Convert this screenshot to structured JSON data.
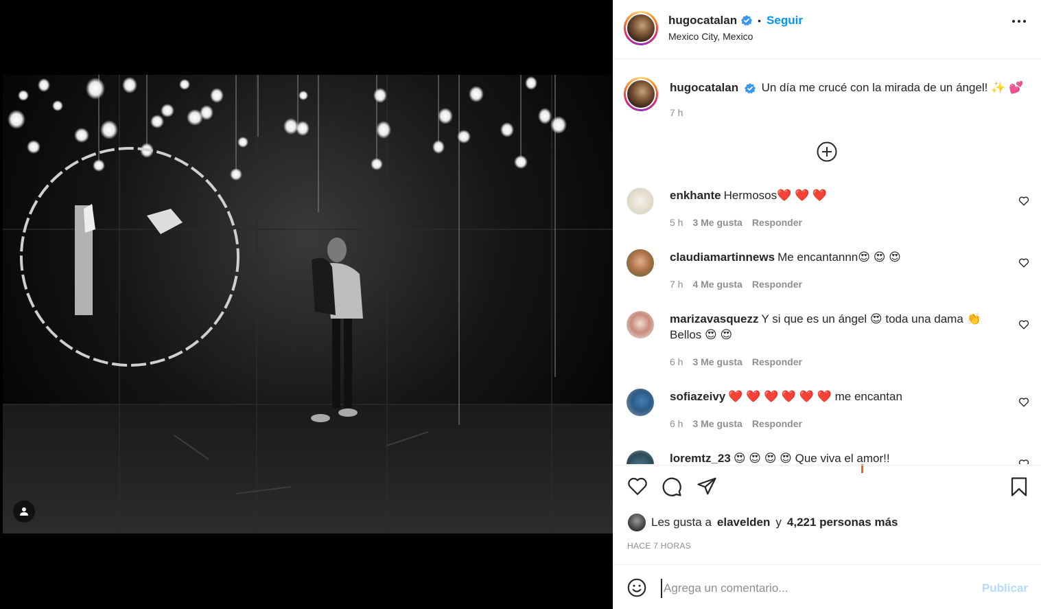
{
  "post": {
    "username": "hugocatalan",
    "verified_icon": "verified-badge-icon",
    "separator": "•",
    "follow_label": "Seguir",
    "location": "Mexico City, Mexico",
    "more_icon": "more-options-icon"
  },
  "caption": {
    "username": "hugocatalan",
    "text": "Un día me crucé con la mirada de un ángel! ✨ 💕",
    "time": "7 h",
    "load_more_icon": "plus-circle-icon"
  },
  "comments": [
    {
      "username": "enkhante",
      "text": "Hermosos❤️ ❤️ ❤️",
      "time": "5 h",
      "likes": "3 Me gusta",
      "reply": "Responder"
    },
    {
      "username": "claudiamartinnews",
      "text": "Me encantannn😍 😍 😍",
      "time": "7 h",
      "likes": "4 Me gusta",
      "reply": "Responder"
    },
    {
      "username": "marizavasquezz",
      "text": "Y si que es un ángel 😍 toda una dama 👏 Bellos 😍 😍",
      "time": "6 h",
      "likes": "3 Me gusta",
      "reply": "Responder"
    },
    {
      "username": "sofiazeivy",
      "text": "❤️ ❤️ ❤️ ❤️ ❤️ ❤️ me encantan",
      "time": "6 h",
      "likes": "3 Me gusta",
      "reply": "Responder"
    },
    {
      "username": "loremtz_23",
      "text": "😍 😍 😍 😍 Que viva el amor!!",
      "time": "",
      "likes": "",
      "reply": ""
    }
  ],
  "actions": {
    "like_icon": "heart-icon",
    "comment_icon": "comment-icon",
    "share_icon": "share-paper-plane-icon",
    "save_icon": "bookmark-icon"
  },
  "likes": {
    "prefix": "Les gusta a",
    "user": "elavelden",
    "conj": "y",
    "others": "4,221 personas más"
  },
  "time_ago": "HACE 7 HORAS",
  "compose": {
    "placeholder": "Agrega un comentario...",
    "publish_label": "Publicar",
    "emoji_icon": "smiley-icon"
  },
  "colors": {
    "accent": "#0095f6",
    "publish_disabled": "#b3dbff",
    "muted": "#8e8e8e",
    "heart_red": "#ed4956"
  }
}
